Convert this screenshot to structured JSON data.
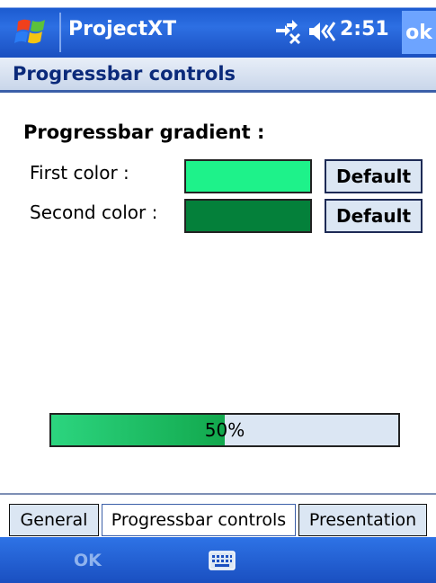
{
  "titlebar": {
    "start_icon": "windows-flag-icon",
    "app_title": "ProjectXT",
    "connectivity_icon": "connectivity-icon",
    "volume_icon": "speaker-volume-icon",
    "time": "2:51",
    "ok_label": "ok"
  },
  "page": {
    "header": "Progressbar controls",
    "section_title": "Progressbar gradient :"
  },
  "colors": {
    "first_label": "First color :",
    "first_value": "#1ef28a",
    "first_default_label": "Default",
    "second_label": "Second color :",
    "second_value": "#04803a",
    "second_default_label": "Default"
  },
  "progress": {
    "value": 0.5,
    "text": "50%"
  },
  "tabs": [
    {
      "label": "General",
      "active": false
    },
    {
      "label": "Progressbar controls",
      "active": true
    },
    {
      "label": "Presentation",
      "active": false
    }
  ],
  "menubar": {
    "left_label": "OK",
    "center_icon": "keyboard-icon"
  },
  "theme": {
    "accent": "#2d6fe3",
    "button_bg": "#dbe6f3"
  }
}
